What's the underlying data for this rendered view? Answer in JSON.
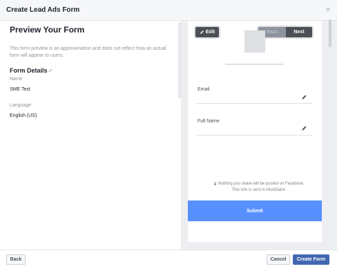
{
  "dialog": {
    "title": "Create Lead Ads Form",
    "close_label": "×"
  },
  "left": {
    "heading": "Preview Your Form",
    "description": "This form preview is an approximation and does not reflect how an actual form will appear to users.",
    "details_heading": "Form Details",
    "name_label": "Name",
    "name_value": "SME Test",
    "language_label": "Language",
    "language_value": "English (US)"
  },
  "preview": {
    "edit_label": "Edit",
    "back_label": "Back",
    "next_label": "Next",
    "fields": [
      {
        "label": "Email"
      },
      {
        "label": "Full Name"
      }
    ],
    "privacy_line1": "Nothing you share will be posted on Facebook.",
    "privacy_line2": "This info is sent to HostGator.",
    "submit_label": "Submit"
  },
  "footer": {
    "back_label": "Back",
    "cancel_label": "Cancel",
    "create_label": "Create Form"
  },
  "colors": {
    "accent": "#4267b2",
    "submit": "#5890ff",
    "dark_button": "#4b4f56"
  },
  "icons": [
    "close-icon",
    "pencil-icon",
    "lock-icon"
  ]
}
